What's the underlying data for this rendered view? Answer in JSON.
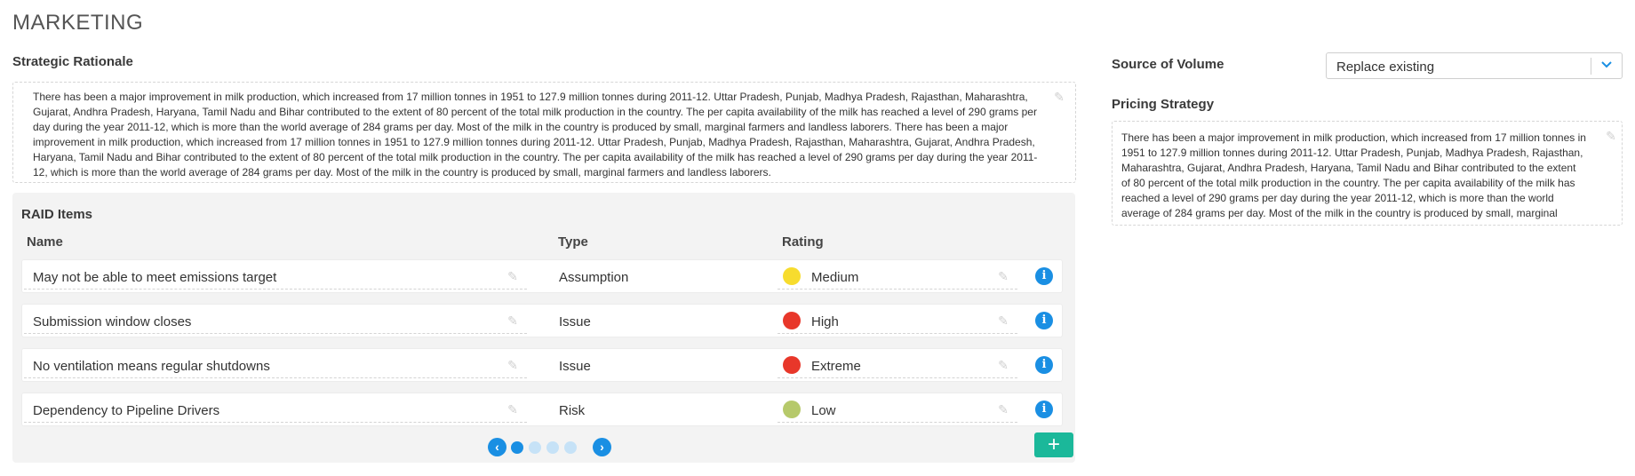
{
  "page": {
    "title": "MARKETING"
  },
  "strategic_rationale": {
    "label": "Strategic Rationale",
    "text": "There has been a major improvement in milk production, which increased from 17 million tonnes in 1951 to 127.9 million tonnes during 2011-12. Uttar Pradesh, Punjab, Madhya Pradesh, Rajasthan, Maharashtra, Gujarat, Andhra Pradesh, Haryana, Tamil Nadu and Bihar contributed to the extent of 80 percent of the total milk production in the country. The per capita availability of the milk has reached a level of 290 grams per day during the year 2011-12, which is more than the world average of 284 grams per day. Most of the milk in the country is produced by small, marginal farmers and landless laborers. There has been a major improvement in milk production, which increased from 17 million tonnes in 1951 to 127.9 million tonnes during 2011-12. Uttar Pradesh, Punjab, Madhya Pradesh, Rajasthan, Maharashtra, Gujarat, Andhra Pradesh, Haryana, Tamil Nadu and Bihar contributed to the extent of 80 percent of the total milk production in the country. The per capita availability of the milk has reached a level of 290 grams per day during the year 2011-12, which is more than the world average of 284 grams per day. Most of the milk in the country is produced by small, marginal farmers and landless laborers."
  },
  "raid": {
    "title": "RAID Items",
    "columns": {
      "name": "Name",
      "type": "Type",
      "rating": "Rating"
    },
    "rows": [
      {
        "name": "May not be able to meet emissions target",
        "type": "Assumption",
        "rating": "Medium",
        "rating_color": "#f7dc2e"
      },
      {
        "name": "Submission window closes",
        "type": "Issue",
        "rating": "High",
        "rating_color": "#e8372a"
      },
      {
        "name": "No ventilation means regular shutdowns",
        "type": "Issue",
        "rating": "Extreme",
        "rating_color": "#e8372a"
      },
      {
        "name": "Dependency to Pipeline Drivers",
        "type": "Risk",
        "rating": "Low",
        "rating_color": "#b6c96a"
      }
    ],
    "pager": {
      "pages": 4,
      "current": 1
    }
  },
  "source_of_volume": {
    "label": "Source of Volume",
    "value": "Replace existing"
  },
  "pricing_strategy": {
    "label": "Pricing Strategy",
    "text": "There has been a major improvement in milk production, which increased from 17 million tonnes in 1951 to 127.9 million tonnes during 2011-12. Uttar Pradesh, Punjab, Madhya Pradesh, Rajasthan, Maharashtra, Gujarat, Andhra Pradesh, Haryana, Tamil Nadu and Bihar contributed to the extent of 80 percent of the total milk production in the country. The per capita availability of the milk has reached a level of 290 grams per day during the year 2011-12, which is more than the world average of 284 grams per day. Most of the milk in the country is produced by small, marginal farmers and landless laborers."
  },
  "colors": {
    "accent": "#1a8fe3",
    "add_button": "#1bb89a"
  },
  "icons": {
    "edit": "pencil-icon",
    "info": "info-icon",
    "prev": "chevron-left-icon",
    "next": "chevron-right-icon",
    "dropdown": "chevron-down-icon",
    "add": "plus-icon"
  }
}
